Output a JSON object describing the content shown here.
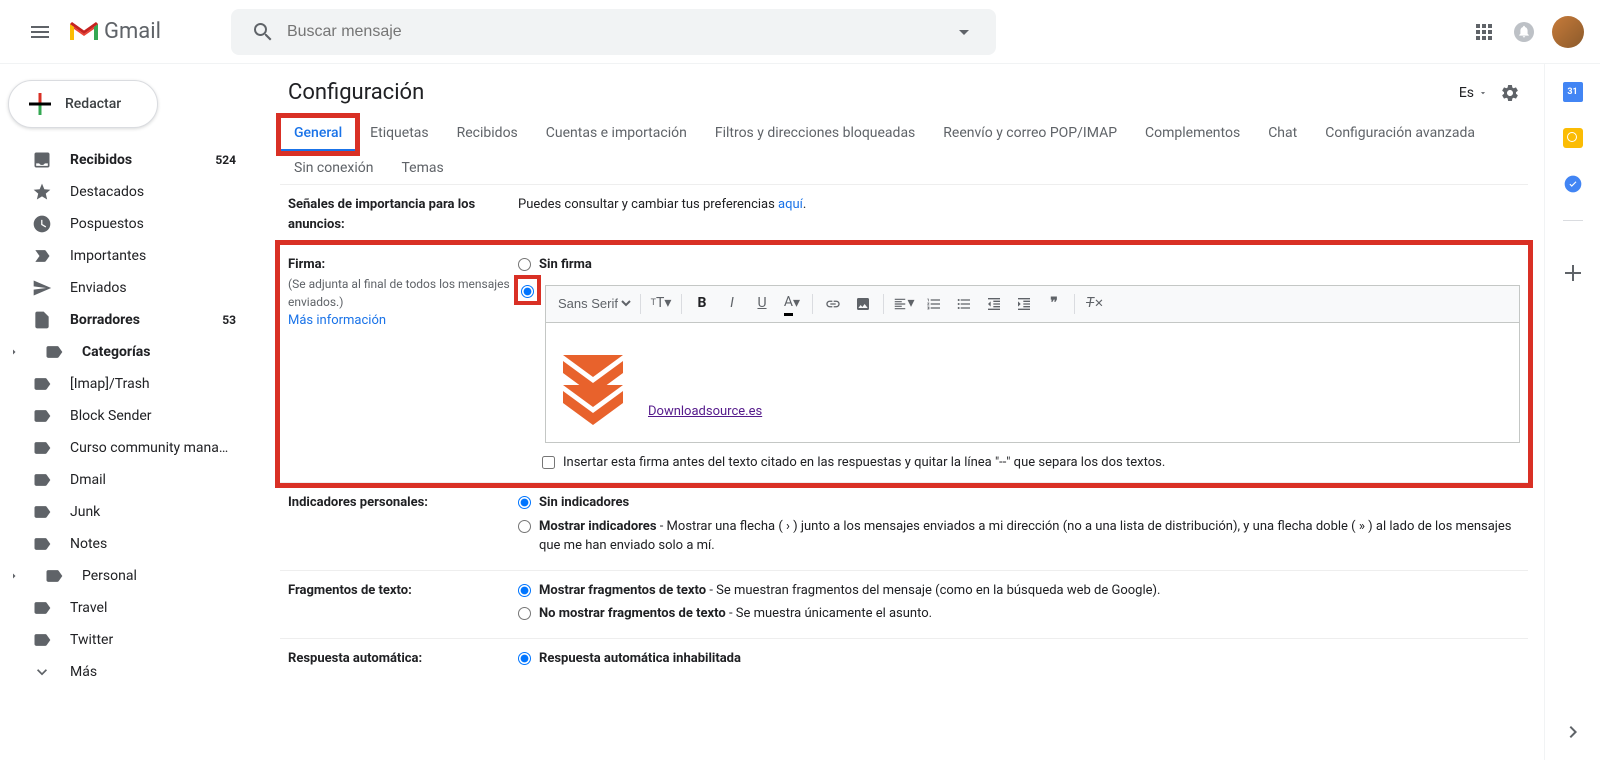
{
  "header": {
    "logo_text": "Gmail",
    "search_placeholder": "Buscar mensaje"
  },
  "compose_label": "Redactar",
  "sidebar": {
    "items": [
      {
        "label": "Recibidos",
        "count": "524",
        "bold": true,
        "icon": "inbox"
      },
      {
        "label": "Destacados",
        "icon": "star"
      },
      {
        "label": "Pospuestos",
        "icon": "clock"
      },
      {
        "label": "Importantes",
        "icon": "important"
      },
      {
        "label": "Enviados",
        "icon": "sent"
      },
      {
        "label": "Borradores",
        "count": "53",
        "bold": true,
        "icon": "draft"
      },
      {
        "label": "Categorías",
        "bold": true,
        "icon": "label",
        "expandable": true
      },
      {
        "label": "[Imap]/Trash",
        "icon": "label"
      },
      {
        "label": "Block Sender",
        "icon": "label"
      },
      {
        "label": "Curso community mana…",
        "icon": "label"
      },
      {
        "label": "Dmail",
        "icon": "label"
      },
      {
        "label": "Junk",
        "icon": "label"
      },
      {
        "label": "Notes",
        "icon": "label"
      },
      {
        "label": "Personal",
        "icon": "label",
        "expandable": true
      },
      {
        "label": "Travel",
        "icon": "label"
      },
      {
        "label": "Twitter",
        "icon": "label"
      },
      {
        "label": "Más",
        "icon": "more"
      }
    ]
  },
  "settings": {
    "title": "Configuración",
    "lang": "Es",
    "tabs": [
      "General",
      "Etiquetas",
      "Recibidos",
      "Cuentas e importación",
      "Filtros y direcciones bloqueadas",
      "Reenvío y correo POP/IMAP",
      "Complementos",
      "Chat",
      "Configuración avanzada",
      "Sin conexión",
      "Temas"
    ],
    "importance": {
      "label": "Señales de importancia para los anuncios:",
      "text": "Puedes consultar y cambiar tus preferencias ",
      "link": "aquí"
    },
    "signature": {
      "label": "Firma:",
      "sub": "(Se adjunta al final de todos los mensajes enviados.)",
      "more": "Más información",
      "opt_none": "Sin firma",
      "font": "Sans Serif",
      "link_text": "Downloadsource.es ",
      "insert_before": "Insertar esta firma antes del texto citado en las respuestas y quitar la línea \"--\" que separa los dos textos."
    },
    "indicators": {
      "label": "Indicadores personales:",
      "none": "Sin indicadores",
      "show_bold": "Mostrar indicadores",
      "show_rest": " - Mostrar una flecha ( › ) junto a los mensajes enviados a mi dirección (no a una lista de distribución), y una flecha doble ( » ) al lado de los mensajes que me han enviado solo a mí."
    },
    "snippets": {
      "label": "Fragmentos de texto:",
      "show_bold": "Mostrar fragmentos de texto",
      "show_rest": " - Se muestran fragmentos del mensaje (como en la búsqueda web de Google).",
      "hide_bold": "No mostrar fragmentos de texto",
      "hide_rest": " - Se muestra únicamente el asunto."
    },
    "vacation": {
      "label": "Respuesta automática:",
      "off": "Respuesta automática inhabilitada"
    }
  }
}
